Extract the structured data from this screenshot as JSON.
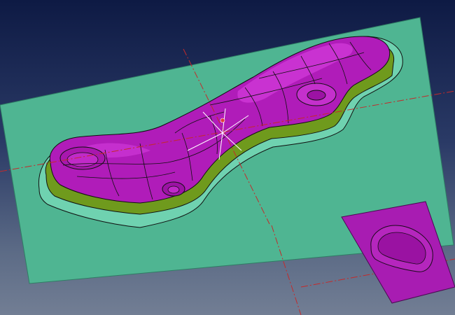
{
  "viewport": {
    "background_top": "#0e1a44",
    "background_bottom": "#727e94"
  },
  "colors": {
    "plate": "#4fb592",
    "plate_edge": "#2f7d64",
    "part_top": "#b01cb9",
    "part_top_light": "#d43cdc",
    "part_side": "#6f9a1d",
    "fillet": "#6fd2b0",
    "wire": "#101010",
    "axis": "#c42a2a",
    "triad": "#ffffff",
    "cavity": "#a81cb2"
  },
  "icons": {
    "triad": "view-triad-icon",
    "pivot": "rotation-pivot-icon"
  }
}
